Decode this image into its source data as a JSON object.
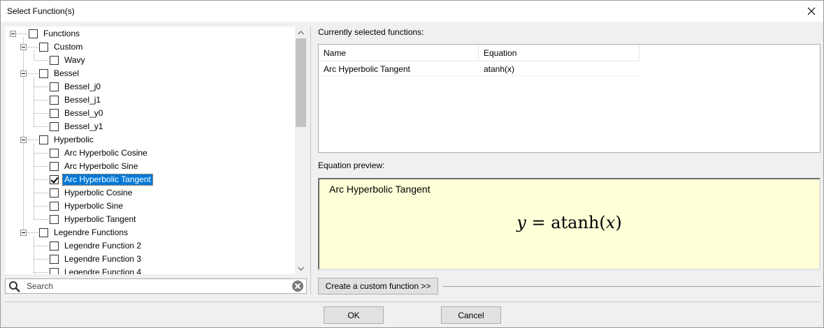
{
  "window": {
    "title": "Select Function(s)"
  },
  "tree": [
    {
      "label": "Functions",
      "checked": false,
      "level": 0,
      "expanded": true
    },
    {
      "label": "Custom",
      "checked": false,
      "level": 1,
      "expanded": true
    },
    {
      "label": "Wavy",
      "checked": false,
      "level": 2
    },
    {
      "label": "Bessel",
      "checked": false,
      "level": 1,
      "expanded": true
    },
    {
      "label": "Bessel_j0",
      "checked": false,
      "level": 2
    },
    {
      "label": "Bessel_j1",
      "checked": false,
      "level": 2
    },
    {
      "label": "Bessel_y0",
      "checked": false,
      "level": 2
    },
    {
      "label": "Bessel_y1",
      "checked": false,
      "level": 2
    },
    {
      "label": "Hyperbolic",
      "checked": false,
      "level": 1,
      "expanded": true
    },
    {
      "label": "Arc Hyperbolic Cosine",
      "checked": false,
      "level": 2
    },
    {
      "label": "Arc Hyperbolic Sine",
      "checked": false,
      "level": 2
    },
    {
      "label": "Arc Hyperbolic Tangent",
      "checked": true,
      "level": 2,
      "selected": true
    },
    {
      "label": "Hyperbolic Cosine",
      "checked": false,
      "level": 2
    },
    {
      "label": "Hyperbolic Sine",
      "checked": false,
      "level": 2
    },
    {
      "label": "Hyperbolic Tangent",
      "checked": false,
      "level": 2
    },
    {
      "label": "Legendre Functions",
      "checked": false,
      "level": 1,
      "expanded": true
    },
    {
      "label": "Legendre Function 2",
      "checked": false,
      "level": 2
    },
    {
      "label": "Legendre Function 3",
      "checked": false,
      "level": 2
    },
    {
      "label": "Legendre Function 4",
      "checked": false,
      "level": 2
    }
  ],
  "search": {
    "placeholder": "Search"
  },
  "selected": {
    "label": "Currently selected functions:",
    "columns": [
      "Name",
      "Equation"
    ],
    "rows": [
      {
        "name": "Arc Hyperbolic Tangent",
        "equation": "atanh(x)"
      }
    ]
  },
  "preview": {
    "label": "Equation preview:",
    "name": "Arc Hyperbolic Tangent",
    "formula": "y = atanh(x)"
  },
  "buttons": {
    "create": "Create a custom function >>",
    "ok": "OK",
    "cancel": "Cancel"
  },
  "colors": {
    "selection": "#0078d7",
    "preview_bg": "#ffffd8"
  }
}
